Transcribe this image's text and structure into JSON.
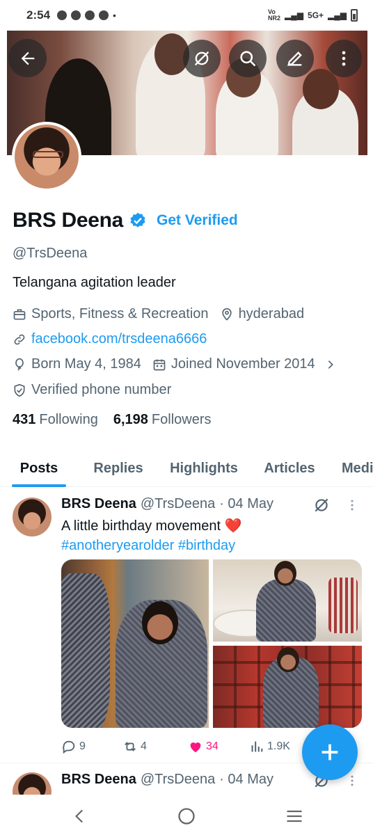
{
  "status_bar": {
    "time": "2:54",
    "network": "5G+",
    "carrier": "Vo NR2"
  },
  "profile": {
    "name": "BRS Deena",
    "get_verified": "Get Verified",
    "handle": "@TrsDeena",
    "bio": "Telangana agitation leader",
    "category": "Sports, Fitness & Recreation",
    "location": "hyderabad",
    "link": "facebook.com/trsdeena6666",
    "born": "Born May 4, 1984",
    "joined": "Joined November 2014",
    "verified_phone": "Verified phone number",
    "following_count": "431",
    "following_label": "Following",
    "followers_count": "6,198",
    "followers_label": "Followers"
  },
  "tabs": [
    {
      "label": "Posts",
      "active": true
    },
    {
      "label": "Replies",
      "active": false
    },
    {
      "label": "Highlights",
      "active": false
    },
    {
      "label": "Articles",
      "active": false
    },
    {
      "label": "Media",
      "active": false
    }
  ],
  "posts": [
    {
      "author": "BRS Deena",
      "handle": "@TrsDeena",
      "date": "· 04 May",
      "text": "A little birthday movement",
      "emoji": "❤️",
      "hashtags": "#anotheryearolder #birthday",
      "replies": "9",
      "reposts": "4",
      "likes": "34",
      "views": "1.9K"
    },
    {
      "author": "BRS Deena",
      "handle": "@TrsDeena",
      "date": "· 04 May"
    }
  ],
  "colors": {
    "accent": "#1d9bf0",
    "like": "#f91880",
    "text": "#0f1419",
    "secondary": "#536471"
  }
}
